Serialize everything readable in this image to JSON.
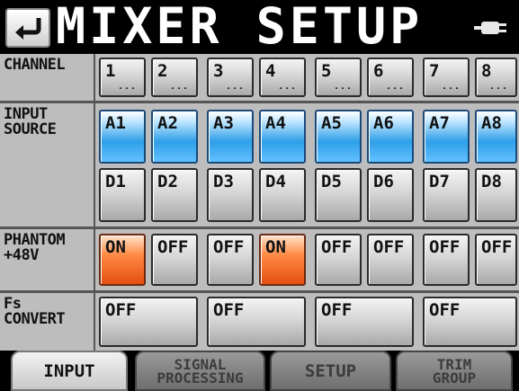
{
  "title": "MIXER SETUP",
  "icons": {
    "back": "return-arrow-icon",
    "power": "power-plug-icon"
  },
  "rows": {
    "channel": {
      "label": "CHANNEL"
    },
    "input_source": {
      "label_line1": "INPUT",
      "label_line2": "SOURCE"
    },
    "phantom": {
      "label_line1": "PHANTOM",
      "label_line2": "+48V"
    },
    "fs_convert": {
      "label_line1": "Fs",
      "label_line2": "CONVERT"
    }
  },
  "channels": [
    {
      "number": "1",
      "dots": "...",
      "analog": "A1",
      "digital": "D1",
      "phantom": "ON"
    },
    {
      "number": "2",
      "dots": "...",
      "analog": "A2",
      "digital": "D2",
      "phantom": "OFF"
    },
    {
      "number": "3",
      "dots": "...",
      "analog": "A3",
      "digital": "D3",
      "phantom": "OFF"
    },
    {
      "number": "4",
      "dots": "...",
      "analog": "A4",
      "digital": "D4",
      "phantom": "ON"
    },
    {
      "number": "5",
      "dots": "...",
      "analog": "A5",
      "digital": "D5",
      "phantom": "OFF"
    },
    {
      "number": "6",
      "dots": "...",
      "analog": "A6",
      "digital": "D6",
      "phantom": "OFF"
    },
    {
      "number": "7",
      "dots": "...",
      "analog": "A7",
      "digital": "D7",
      "phantom": "OFF"
    },
    {
      "number": "8",
      "dots": "...",
      "analog": "A8",
      "digital": "D8",
      "phantom": "OFF"
    }
  ],
  "fs_convert": [
    "OFF",
    "OFF",
    "OFF",
    "OFF"
  ],
  "tabs": [
    {
      "line1": "INPUT",
      "line2": "",
      "active": true
    },
    {
      "line1": "SIGNAL",
      "line2": "PROCESSING",
      "active": false
    },
    {
      "line1": "SETUP",
      "line2": "",
      "active": false
    },
    {
      "line1": "TRIM",
      "line2": "GROUP",
      "active": false
    }
  ],
  "colors": {
    "selected": "#2e9fe8",
    "phantom_on": "#e54f10",
    "background": "#000000"
  }
}
